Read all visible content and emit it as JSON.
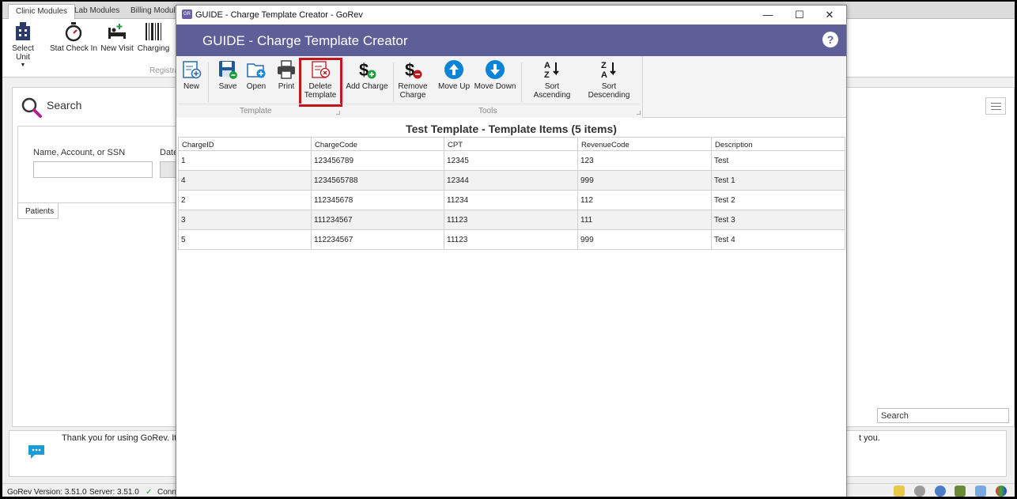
{
  "background_app": {
    "module_tabs": [
      "Clinic Modules",
      "Lab Modules",
      "Billing Modules"
    ],
    "ribbon_tools": [
      "Select Unit",
      "Stat Check In",
      "New Visit",
      "Charging"
    ],
    "ribbon_group": "Registra",
    "search": {
      "title": "Search",
      "name_label": "Name, Account, or SSN",
      "date_label": "Date",
      "tab": "Patients",
      "grid_search_placeholder": "Search"
    },
    "message": {
      "text": "Thank you for using GoRev.  It",
      "tail": "t you."
    },
    "status": {
      "version": "GoRev Version: 3.51.0",
      "server": "Server: 3.51.0",
      "connection": "Conn"
    }
  },
  "window": {
    "title": "GUIDE - Charge Template Creator - GoRev",
    "header_title": "GUIDE - Charge Template Creator",
    "controls": {
      "minimize": "—",
      "maximize": "☐",
      "close": "✕"
    },
    "ribbon": {
      "groups": [
        {
          "label": "Template"
        },
        {
          "label": "Tools"
        }
      ],
      "tools": {
        "new": "New",
        "save": "Save",
        "open": "Open",
        "print": "Print",
        "delete_template_1": "Delete",
        "delete_template_2": "Template",
        "add_charge": "Add Charge",
        "remove_charge_1": "Remove",
        "remove_charge_2": "Charge",
        "move_up": "Move Up",
        "move_down": "Move Down",
        "sort_ascending": "Sort Ascending",
        "sort_descending": "Sort Descending"
      },
      "colors": {
        "accent": "#0a84d6",
        "highlight": "#c0161c",
        "header": "#5f5f98"
      }
    },
    "grid": {
      "title": "Test Template - Template Items (5 items)",
      "columns": [
        "ChargeID",
        "ChargeCode",
        "CPT",
        "RevenueCode",
        "Description"
      ],
      "rows": [
        [
          "1",
          "123456789",
          "12345",
          "123",
          "Test"
        ],
        [
          "4",
          "1234565788",
          "12344",
          "999",
          "Test 1"
        ],
        [
          "2",
          "112345678",
          "11234",
          "112",
          "Test 2"
        ],
        [
          "3",
          "111234567",
          "11123",
          "111",
          "Test 3"
        ],
        [
          "5",
          "112234567",
          "11123",
          "999",
          "Test 4"
        ]
      ]
    }
  }
}
